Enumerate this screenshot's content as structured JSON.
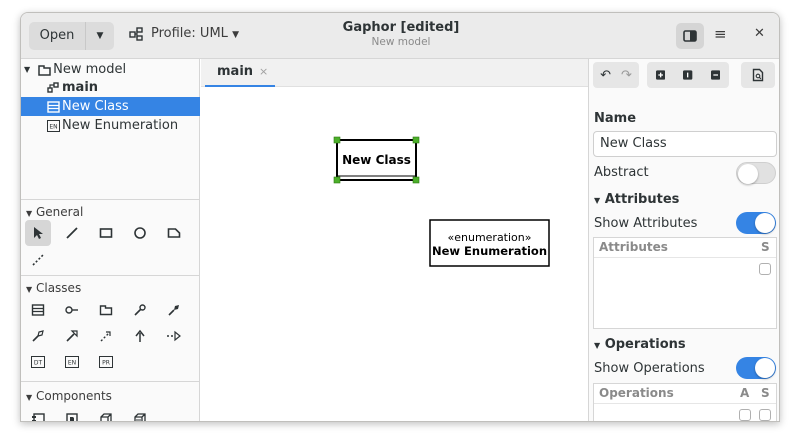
{
  "header": {
    "open_label": "Open",
    "profile_label": "Profile: UML",
    "title": "Gaphor [edited]",
    "subtitle": "New model"
  },
  "tree": {
    "root": "New model",
    "diagram": "main",
    "items": [
      "New Class",
      "New Enumeration"
    ]
  },
  "toolbox": {
    "general": "General",
    "classes": "Classes",
    "components": "Components",
    "stereo_labels": [
      "DT",
      "EN",
      "PR"
    ]
  },
  "tab": {
    "label": "main",
    "close": "×"
  },
  "canvas": {
    "class_name": "New Class",
    "enum_stereotype": "«enumeration»",
    "enum_name": "New Enumeration"
  },
  "properties": {
    "name_label": "Name",
    "name_value": "New Class",
    "abstract_label": "Abstract",
    "abstract_on": false,
    "attributes_header": "Attributes",
    "show_attributes_label": "Show Attributes",
    "show_attributes_on": true,
    "attributes_col": "Attributes",
    "attributes_s_col": "S",
    "operations_header": "Operations",
    "show_operations_label": "Show Operations",
    "show_operations_on": true,
    "operations_col": "Operations",
    "operations_a_col": "A",
    "operations_s_col": "S"
  },
  "colors": {
    "accent": "#3584e4",
    "selection_handle": "#4caf2a"
  }
}
